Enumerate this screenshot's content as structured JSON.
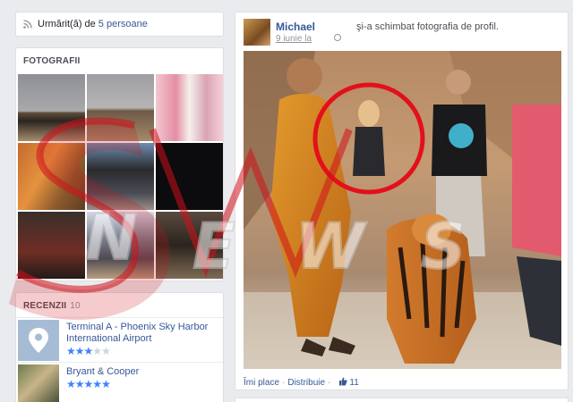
{
  "followers": {
    "text": "Urmărit(ă) de",
    "link": "5 persoane",
    "icon": "rss-icon"
  },
  "photos": {
    "title": "FOTOGRAFII",
    "tiles": [
      {
        "desc": "pyramids"
      },
      {
        "desc": "pyramids-close"
      },
      {
        "desc": "group-women"
      },
      {
        "desc": "monks"
      },
      {
        "desc": "car-street"
      },
      {
        "desc": "night"
      },
      {
        "desc": "party"
      },
      {
        "desc": "crowd"
      },
      {
        "desc": "tiger"
      }
    ]
  },
  "reviews": {
    "title": "RECENZII",
    "count": "10",
    "items": [
      {
        "name": "Terminal A - Phoenix Sky Harbor International Airport",
        "rating": 3,
        "max": 5,
        "thumb": "map-pin-icon"
      },
      {
        "name": "Bryant & Cooper",
        "rating": 5,
        "max": 5,
        "thumb": "restaurant-photo"
      }
    ]
  },
  "post": {
    "author": "Michael",
    "action": "şi-a schimbat fotografia de profil.",
    "date": "9 iunie la",
    "footer": {
      "like": "Îmi place",
      "share": "Distribuie",
      "like_count": "11"
    }
  },
  "watermark": {
    "text": "SW NEWS",
    "color": "#d0101a"
  },
  "colors": {
    "link": "#365899",
    "star": "#4080ff",
    "bg": "#e9ebee"
  }
}
